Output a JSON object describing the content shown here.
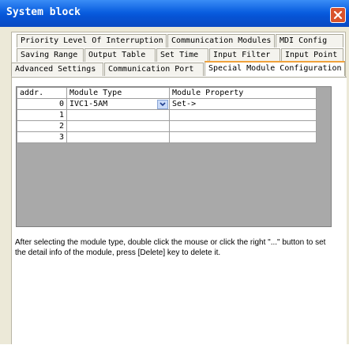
{
  "window": {
    "title": "System block"
  },
  "tabs": {
    "row1": [
      "Priority Level Of Interruption",
      "Communication Modules",
      "MDI Config"
    ],
    "row2": [
      "Saving Range",
      "Output Table",
      "Set Time",
      "Input Filter",
      "Input Point"
    ],
    "row3": [
      "Advanced Settings",
      "Communication Port",
      "Special Module Configuration"
    ]
  },
  "grid": {
    "headers": [
      "addr.",
      "Module Type",
      "Module Property"
    ],
    "rows": [
      {
        "addr": "0",
        "type": "IVC1-5AM",
        "property": "Set->"
      },
      {
        "addr": "1",
        "type": "",
        "property": ""
      },
      {
        "addr": "2",
        "type": "",
        "property": ""
      },
      {
        "addr": "3",
        "type": "",
        "property": ""
      }
    ]
  },
  "info_text": "After selecting the module type, double click the mouse or click the right \"...\" button to set the detail info of the module, press [Delete] key to delete it.",
  "colors": {
    "title_bar": "#0654d6",
    "active_tab_accent": "#f0a23c",
    "grid_background": "#a9a9a9"
  }
}
